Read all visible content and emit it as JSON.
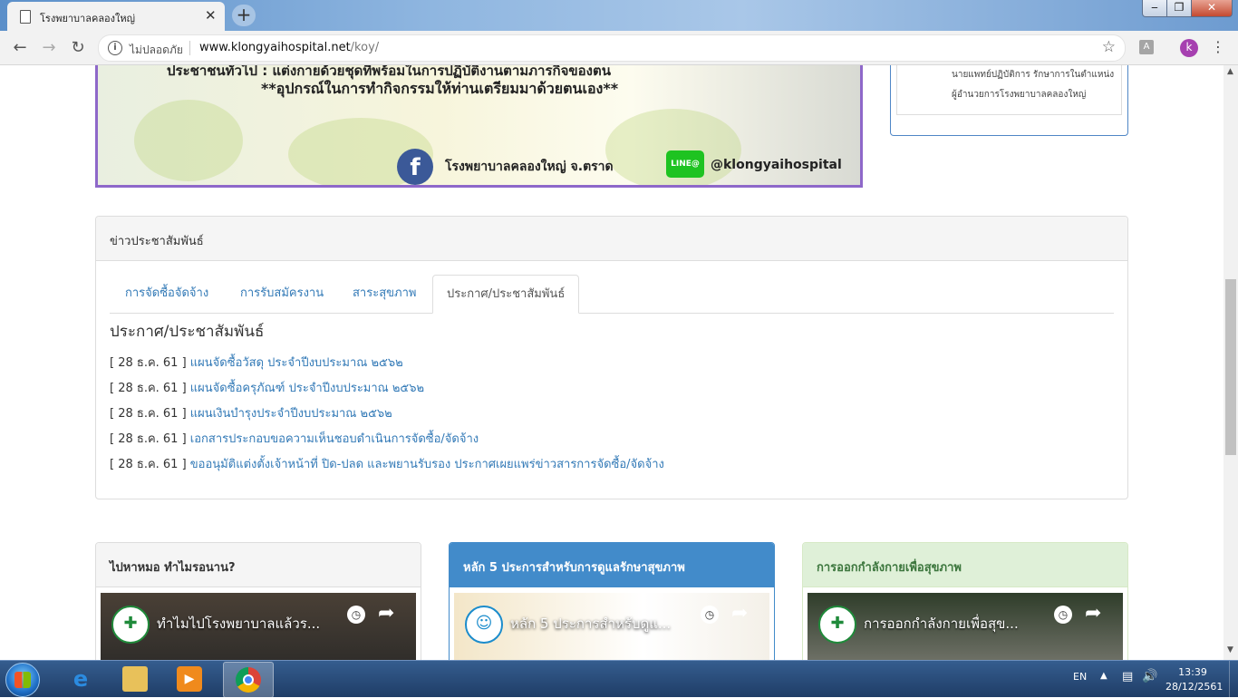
{
  "browser": {
    "tab_title": "โรงพยาบาลคลองใหญ่",
    "tab_close": "✕",
    "new_tab": "+",
    "security_label": "ไม่ปลอดภัย",
    "url_host": "www.klongyaihospital.net",
    "url_path": "/koy/",
    "profile_initial": "k",
    "win_minimize": "‒",
    "win_maximize": "❐",
    "win_close": "✕"
  },
  "banner": {
    "line1": "ประชาชนทั่วไป : แต่งกายด้วยชุดที่พร้อมในการปฏิบัติงานตามภารกิจของตน",
    "line2": "**อุปกรณ์ในการทำกิจกรรมให้ท่านเตรียมมาด้วยตนเอง**",
    "facebook_letter": "f",
    "facebook_page": "โรงพยาบาลคลองใหญ่ จ.ตราด",
    "line_badge": "LINE@",
    "line_id": "@klongyaihospital"
  },
  "director": {
    "line1": "นายแพทย์ปฏิบัติการ รักษาการในตำแหน่ง",
    "line2": "ผู้อำนวยการโรงพยาบาลคลองใหญ่"
  },
  "news": {
    "header": "ข่าวประชาสัมพันธ์",
    "tabs": [
      "การจัดซื้อจัดจ้าง",
      "การรับสมัครงาน",
      "สาระสุขภาพ",
      "ประกาศ/ประชาสัมพันธ์"
    ],
    "active_tab": 3,
    "section_title": "ประกาศ/ประชาสัมพันธ์",
    "items": [
      {
        "date": "[ 28 ธ.ค. 61 ]",
        "title": "แผนจัดซื้อวัสดุ ประจำปีงบประมาณ ๒๕๖๒"
      },
      {
        "date": "[ 28 ธ.ค. 61 ]",
        "title": "แผนจัดซื้อครุภัณฑ์ ประจำปีงบประมาณ ๒๕๖๒"
      },
      {
        "date": "[ 28 ธ.ค. 61 ]",
        "title": "แผนเงินบำรุงประจำปีงบประมาณ ๒๕๖๒"
      },
      {
        "date": "[ 28 ธ.ค. 61 ]",
        "title": "เอกสารประกอบขอความเห็นชอบดำเนินการจัดซื้อ/จัดจ้าง"
      },
      {
        "date": "[ 28 ธ.ค. 61 ]",
        "title": "ขออนุมัติแต่งตั้งเจ้าหน้าที่ ปิด-ปลด และพยานรับรอง ประกาศเผยแพร่ข่าวสารการจัดซื้อ/จัดจ้าง"
      }
    ]
  },
  "cards": [
    {
      "title": "ไปหาหมอ ทำไมรอนาน?",
      "video_title": "ทำไมไปโรงพยาบาลแล้วร...",
      "color_header_bg": "#f5f5f5",
      "color_border": "#dddddd",
      "color_text": "#333333"
    },
    {
      "title": "หลัก 5 ประการสำหรับการดูแลรักษาสุขภาพ",
      "video_title": "หลัก 5 ประการสำหรับดูแ...",
      "color_header_bg": "#428bca",
      "color_border": "#428bca",
      "color_text": "#ffffff"
    },
    {
      "title": "การออกกำลังกายเพื่อสุขภาพ",
      "video_title": "การออกกำลังกายเพื่อสุข...",
      "color_header_bg": "#dff0d8",
      "color_border": "#d6e9c6",
      "color_text": "#3c763d"
    }
  ],
  "taskbar": {
    "lang": "EN",
    "time": "13:39",
    "date": "28/12/2561"
  },
  "icons": {
    "back": "←",
    "forward": "→",
    "reload": "↻",
    "star": "☆",
    "menu": "⋮",
    "info": "i",
    "clock": "◷",
    "share": "➦"
  }
}
